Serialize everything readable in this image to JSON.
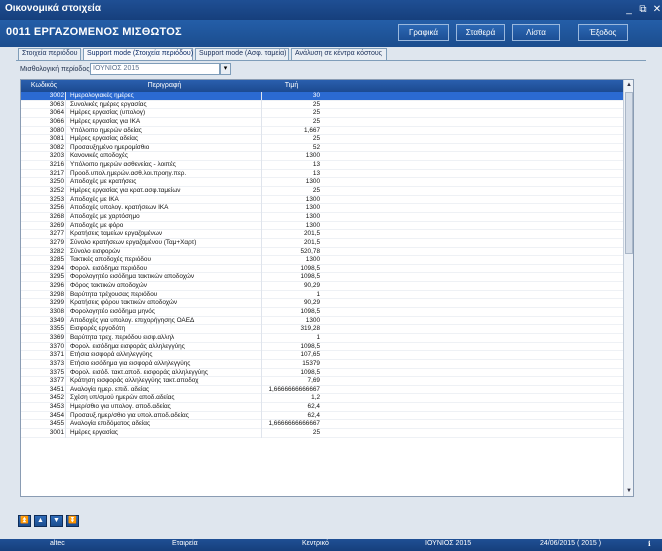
{
  "window": {
    "title": "Οικονομικά στοιχεία",
    "minimize": "_",
    "restore": "⧉",
    "close": "✕"
  },
  "header": {
    "title": "0011  ΕΡΓΑΖΟΜΕΝΟΣ ΜΙΣΘΩΤΟΣ",
    "buttons": {
      "charts": "Γραφικά",
      "fixed": "Σταθερά",
      "list": "Λίστα",
      "exit": "Έξοδος"
    }
  },
  "tabs": [
    {
      "label": "Στοιχεία περιόδου"
    },
    {
      "label": "Support mode (Στοιχεία περιόδου)"
    },
    {
      "label": "Support mode (Ασφ. ταμεία)"
    },
    {
      "label": "Ανάλυση σε κέντρα κόστους"
    }
  ],
  "period": {
    "label": "Μισθολογική περίοδος",
    "value": "ΙΟΥΝΙΟΣ 2015"
  },
  "table": {
    "columns": [
      "Κωδικός",
      "Περιγραφή",
      "Τιμή"
    ],
    "rows": [
      [
        "3002",
        "Ημερολογιακές ημέρες",
        "30"
      ],
      [
        "3063",
        "Συνολικές ημέρες εργασίας",
        "25"
      ],
      [
        "3064",
        "Ημέρες εργασίας (υπολογ)",
        "25"
      ],
      [
        "3066",
        "Ημέρες εργασίας για ΙΚΑ",
        "25"
      ],
      [
        "3080",
        "Υπόλοιπο ημερών αδείας",
        "1,667"
      ],
      [
        "3081",
        "Ημέρες εργασίας αδείας",
        "25"
      ],
      [
        "3082",
        "Προσαυξημένο ημερομίσθιο",
        "52"
      ],
      [
        "3203",
        "Κανονικές αποδοχές",
        "1300"
      ],
      [
        "3216",
        "Υπόλοιπο ημερών ασθενείας - λοιπές",
        "13"
      ],
      [
        "3217",
        "Προοδ.υπολ.ημερών.ασθ.λοι.προηγ.περ.",
        "13"
      ],
      [
        "3250",
        "Αποδοχές με κρατήσεις",
        "1300"
      ],
      [
        "3252",
        "Ημέρες εργασίας για κρατ.ασφ.ταμείων",
        "25"
      ],
      [
        "3253",
        "Αποδοχές με ΙΚΑ",
        "1300"
      ],
      [
        "3256",
        "Αποδοχές υπολογ. κρατήσεων ΙΚΑ",
        "1300"
      ],
      [
        "3268",
        "Αποδοχές με χαρτόσημο",
        "1300"
      ],
      [
        "3269",
        "Αποδοχές με φόρο",
        "1300"
      ],
      [
        "3277",
        "Κρατήσεις ταμείων εργαζομένων",
        "201,5"
      ],
      [
        "3279",
        "Σύνολο κρατήσεων εργαζομένου (Ταμ+Χαρτ)",
        "201,5"
      ],
      [
        "3282",
        "Σύνολο εισφορών",
        "520,78"
      ],
      [
        "3285",
        "Τακτικές αποδοχές περιόδου",
        "1300"
      ],
      [
        "3294",
        "Φορολ. εισόδημα περιόδου",
        "1098,5"
      ],
      [
        "3295",
        "Φορολογητέο εισόδημα τακτικών αποδοχών",
        "1098,5"
      ],
      [
        "3296",
        "Φόρος τακτικών αποδοχών",
        "90,29"
      ],
      [
        "3298",
        "Βαρύτητα τρέχουσας περιόδου",
        "1"
      ],
      [
        "3299",
        "Κρατήσεις φόρου τακτικών αποδοχών",
        "90,29"
      ],
      [
        "3308",
        "Φορολογητέο εισόδημα μηνός",
        "1098,5"
      ],
      [
        "3349",
        "Αποδοχές για υπολογ. επιχορήγησης ΟΑΕΔ",
        "1300"
      ],
      [
        "3355",
        "Εισφορές εργοδότη",
        "319,28"
      ],
      [
        "3369",
        "Βαρύτητα τρεχ. περιόδου εισφ.αλληλ",
        "1"
      ],
      [
        "3370",
        "Φορολ. εισόδημα εισφοράς αλληλεγγύης",
        "1098,5"
      ],
      [
        "3371",
        "Ετήσια εισφορά αλληλεγγύης",
        "107,65"
      ],
      [
        "3373",
        "Ετήσιο εισόδημα για εισφορά αλληλεγγύης",
        "15379"
      ],
      [
        "3375",
        "Φορολ. εισόδ. τακτ.αποδ. εισφοράς αλληλεγγύης",
        "1098,5"
      ],
      [
        "3377",
        "Κράτηση εισφοράς αλληλεγγύης τακτ.αποδοχ",
        "7,69"
      ],
      [
        "3451",
        "Αναλογία ημερ. επιδ. αδείας",
        "1,6666666666667"
      ],
      [
        "3452",
        "Σχέση υπ/σμού ημερών αποδ.αδείας",
        "1,2"
      ],
      [
        "3453",
        "Ημερ/σθιο για υπολογ. αποδ.αδείας",
        "62,4"
      ],
      [
        "3454",
        "Προσαυξ.ημερ/σθιο για υπολ.αποδ.αδείας",
        "62,4"
      ],
      [
        "3455",
        "Αναλογία επιδόματος αδείας",
        "1,6666666666667"
      ],
      [
        "3001",
        "Ημέρες εργασίας",
        "25"
      ]
    ]
  },
  "navigation": {
    "first": "⏫",
    "prev": "▲",
    "next": "▼",
    "last": "⏬"
  },
  "statusbar": {
    "app": "altec",
    "company": "Εταιρεία",
    "branch": "Κεντρικό",
    "period": "ΙΟΥΝΙΟΣ 2015",
    "date": "24/06/2015  ( 2015 )",
    "info": "ℹ"
  }
}
